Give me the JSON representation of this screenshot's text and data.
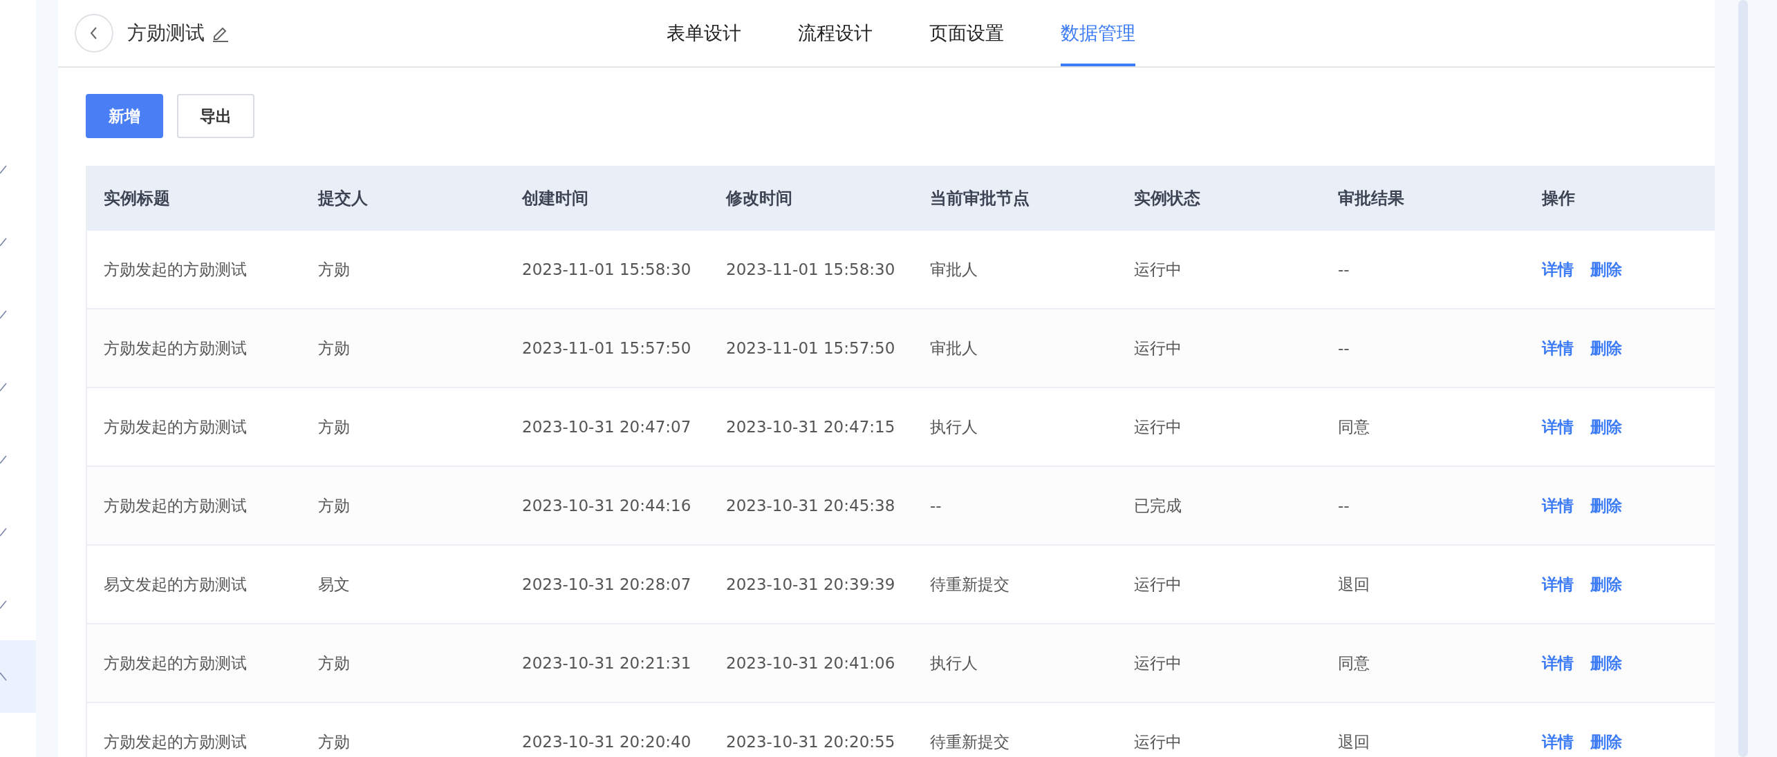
{
  "sidebar": {
    "items": [
      {
        "expanded": false,
        "selected": false
      },
      {
        "expanded": false,
        "selected": false
      },
      {
        "expanded": false,
        "selected": false
      },
      {
        "expanded": false,
        "selected": false
      },
      {
        "expanded": false,
        "selected": false
      },
      {
        "expanded": false,
        "selected": false
      },
      {
        "expanded": false,
        "selected": false
      },
      {
        "expanded": true,
        "selected": true
      }
    ]
  },
  "header": {
    "title": "方勋测试",
    "tabs": [
      {
        "label": "表单设计",
        "selected": false
      },
      {
        "label": "流程设计",
        "selected": false
      },
      {
        "label": "页面设置",
        "selected": false
      },
      {
        "label": "数据管理",
        "selected": true
      }
    ]
  },
  "toolbar": {
    "buttons": [
      {
        "label": "新增",
        "kind": "primary"
      },
      {
        "label": "导出",
        "kind": "default"
      }
    ]
  },
  "table": {
    "columns": [
      "实例标题",
      "提交人",
      "创建时间",
      "修改时间",
      "当前审批节点",
      "实例状态",
      "审批结果",
      "操作"
    ],
    "rows": [
      {
        "cells": [
          "方勋发起的方勋测试",
          "方勋",
          "2023-11-01 15:58:30",
          "2023-11-01 15:58:30",
          "审批人",
          "运行中",
          "--"
        ],
        "actions": [
          "详情",
          "删除"
        ]
      },
      {
        "cells": [
          "方勋发起的方勋测试",
          "方勋",
          "2023-11-01 15:57:50",
          "2023-11-01 15:57:50",
          "审批人",
          "运行中",
          "--"
        ],
        "actions": [
          "详情",
          "删除"
        ]
      },
      {
        "cells": [
          "方勋发起的方勋测试",
          "方勋",
          "2023-10-31 20:47:07",
          "2023-10-31 20:47:15",
          "执行人",
          "运行中",
          "同意"
        ],
        "actions": [
          "详情",
          "删除"
        ]
      },
      {
        "cells": [
          "方勋发起的方勋测试",
          "方勋",
          "2023-10-31 20:44:16",
          "2023-10-31 20:45:38",
          "--",
          "已完成",
          "--"
        ],
        "actions": [
          "详情",
          "删除"
        ]
      },
      {
        "cells": [
          "易文发起的方勋测试",
          "易文",
          "2023-10-31 20:28:07",
          "2023-10-31 20:39:39",
          "待重新提交",
          "运行中",
          "退回"
        ],
        "actions": [
          "详情",
          "删除"
        ]
      },
      {
        "cells": [
          "方勋发起的方勋测试",
          "方勋",
          "2023-10-31 20:21:31",
          "2023-10-31 20:41:06",
          "执行人",
          "运行中",
          "同意"
        ],
        "actions": [
          "详情",
          "删除"
        ]
      },
      {
        "cells": [
          "方勋发起的方勋测试",
          "方勋",
          "2023-10-31 20:20:40",
          "2023-10-31 20:20:55",
          "待重新提交",
          "运行中",
          "退回"
        ],
        "actions": [
          "详情",
          "删除"
        ]
      }
    ]
  }
}
